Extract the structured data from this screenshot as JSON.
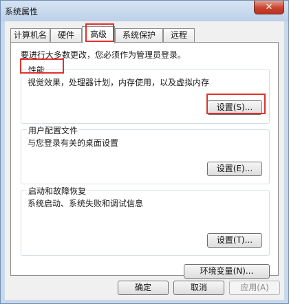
{
  "window": {
    "title": "系统属性",
    "close_label": "✕"
  },
  "tabs": [
    {
      "label": "计算机名"
    },
    {
      "label": "硬件"
    },
    {
      "label": "高级"
    },
    {
      "label": "系统保护"
    },
    {
      "label": "远程"
    }
  ],
  "notice": "要进行大多数更改，您必须作为管理员登录。",
  "performance": {
    "title": "性能",
    "desc": "视觉效果，处理器计划，内存使用，以及虚拟内存",
    "button": "设置(S)..."
  },
  "profiles": {
    "title": "用户配置文件",
    "desc": "与您登录有关的桌面设置",
    "button": "设置(E)..."
  },
  "startup": {
    "title": "启动和故障恢复",
    "desc": "系统启动、系统失败和调试信息",
    "button": "设置(T)..."
  },
  "env_button": "环境变量(N)...",
  "footer": {
    "ok": "确定",
    "cancel": "取消",
    "apply": "应用(A)"
  },
  "colors": {
    "highlight": "#e1302c",
    "titlebar": "#c9d8ea",
    "close": "#c8452f"
  }
}
